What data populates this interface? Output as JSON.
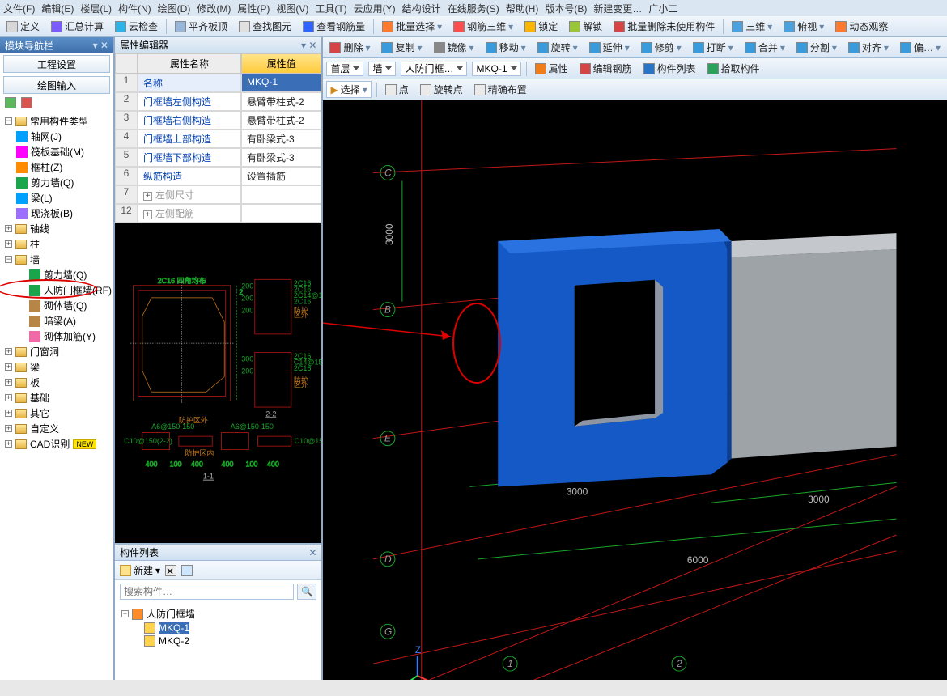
{
  "menubar": [
    "文件(F)",
    "编辑(E)",
    "楼层(L)",
    "构件(N)",
    "绘图(D)",
    "修改(M)",
    "属性(P)",
    "视图(V)",
    "工具(T)",
    "云应用(Y)",
    "结构设计",
    "在线服务(S)",
    "帮助(H)",
    "版本号(B)",
    "新建变更…",
    "广小二"
  ],
  "toolbar1": {
    "items": [
      {
        "label": "定义",
        "icon": "#d8d8d8"
      },
      {
        "label": "汇总计算",
        "icon": "#7a5cff"
      },
      {
        "label": "云检查",
        "icon": "#2fb2e6"
      },
      {
        "label": "平齐板顶",
        "icon": "#98b6d8"
      },
      {
        "label": "查找图元",
        "icon": "#e0e0e0"
      },
      {
        "label": "查看钢筋量",
        "icon": "#3064ff"
      },
      {
        "label": "批量选择",
        "icon": "#ff7a2a"
      },
      {
        "label": "钢筋三维",
        "icon": "#ff4d4d"
      },
      {
        "label": "锁定",
        "icon": "#ffb400"
      },
      {
        "label": "解锁",
        "icon": "#9ac43a"
      },
      {
        "label": "批量删除未使用构件",
        "icon": "#d64545"
      },
      {
        "label": "三维",
        "icon": "#4aa3e0"
      },
      {
        "label": "俯视",
        "icon": "#4aa3e0"
      },
      {
        "label": "动态观察",
        "icon": "#ff7a2a"
      }
    ]
  },
  "nav": {
    "title": "模块导航栏",
    "tabs": {
      "project": "工程设置",
      "draw": "绘图输入"
    }
  },
  "tree": {
    "root": "常用构件类型",
    "root_children": [
      {
        "label": "轴网(J)",
        "icon": "#00a0ff"
      },
      {
        "label": "筏板基础(M)",
        "icon": "#ff00ff"
      },
      {
        "label": "框柱(Z)",
        "icon": "#ff8c00"
      },
      {
        "label": "剪力墙(Q)",
        "icon": "#1aa54c"
      },
      {
        "label": "梁(L)",
        "icon": "#00a0ff"
      },
      {
        "label": "现浇板(B)",
        "icon": "#9d6fff"
      }
    ],
    "groups": [
      {
        "name": "轴线"
      },
      {
        "name": "柱"
      },
      {
        "name": "墙",
        "children": [
          {
            "label": "剪力墙(Q)",
            "icon": "#1aa54c"
          },
          {
            "label": "人防门框墙(RF)",
            "icon": "#1aa54c",
            "highlight": true
          },
          {
            "label": "砌体墙(Q)",
            "icon": "#b78546"
          },
          {
            "label": "暗梁(A)",
            "icon": "#b78546"
          },
          {
            "label": "砌体加筋(Y)",
            "icon": "#ef6aa7"
          }
        ]
      },
      {
        "name": "门窗洞"
      },
      {
        "name": "梁"
      },
      {
        "name": "板"
      },
      {
        "name": "基础"
      },
      {
        "name": "其它"
      },
      {
        "name": "自定义"
      },
      {
        "name": "CAD识别",
        "badge": "NEW"
      }
    ]
  },
  "prop": {
    "title": "属性编辑器",
    "head": {
      "name": "属性名称",
      "value": "属性值"
    },
    "rows": [
      {
        "n": "1",
        "name": "名称",
        "value": "MKQ-1",
        "sel": true
      },
      {
        "n": "2",
        "name": "门框墙左侧构造",
        "value": "悬臂带柱式-2"
      },
      {
        "n": "3",
        "name": "门框墙右侧构造",
        "value": "悬臂带柱式-2"
      },
      {
        "n": "4",
        "name": "门框墙上部构造",
        "value": "有卧梁式-3"
      },
      {
        "n": "5",
        "name": "门框墙下部构造",
        "value": "有卧梁式-3"
      },
      {
        "n": "6",
        "name": "纵筋构造",
        "value": "设置插筋"
      },
      {
        "n": "7",
        "name": "左侧尺寸",
        "value": "",
        "exp": "+",
        "grey": true
      },
      {
        "n": "12",
        "name": "左侧配筋",
        "value": "",
        "exp": "+",
        "grey": true
      }
    ]
  },
  "clist": {
    "title": "构件列表",
    "newbtn": "新建",
    "search_placeholder": "搜索构件…",
    "root": "人防门框墙",
    "items": [
      "MKQ-1",
      "MKQ-2"
    ],
    "selected": "MKQ-1"
  },
  "right_bar1": [
    {
      "label": "删除",
      "icon": "#d64545"
    },
    {
      "label": "复制",
      "icon": "#3a9bdc"
    },
    {
      "label": "镜像",
      "icon": "#888"
    },
    {
      "label": "移动",
      "icon": "#3a9bdc"
    },
    {
      "label": "旋转",
      "icon": "#3a9bdc"
    },
    {
      "label": "延伸",
      "icon": "#3a9bdc"
    },
    {
      "label": "修剪",
      "icon": "#3a9bdc"
    },
    {
      "label": "打断",
      "icon": "#3a9bdc"
    },
    {
      "label": "合并",
      "icon": "#3a9bdc"
    },
    {
      "label": "分割",
      "icon": "#3a9bdc"
    },
    {
      "label": "对齐",
      "icon": "#3a9bdc"
    },
    {
      "label": "偏…",
      "icon": "#3a9bdc"
    }
  ],
  "right_bar2": {
    "dropdowns": [
      "首层",
      "墙",
      "人防门框…",
      "MKQ-1"
    ],
    "tools": [
      "属性",
      "编辑钢筋",
      "构件列表",
      "拾取构件"
    ],
    "tool_icons": [
      "#f07c1a",
      "#d64545",
      "#2a74c7",
      "#2aa35a"
    ]
  },
  "right_bar3": {
    "select": "选择",
    "items": [
      "点",
      "旋转点",
      "精确布置"
    ]
  },
  "viewport": {
    "grid_labels": [
      "C",
      "B",
      "E",
      "D",
      "G"
    ],
    "dims": [
      "3000",
      "3000",
      "3000",
      "6000"
    ],
    "axis_num": [
      "1",
      "2"
    ],
    "z_label": "Z"
  }
}
